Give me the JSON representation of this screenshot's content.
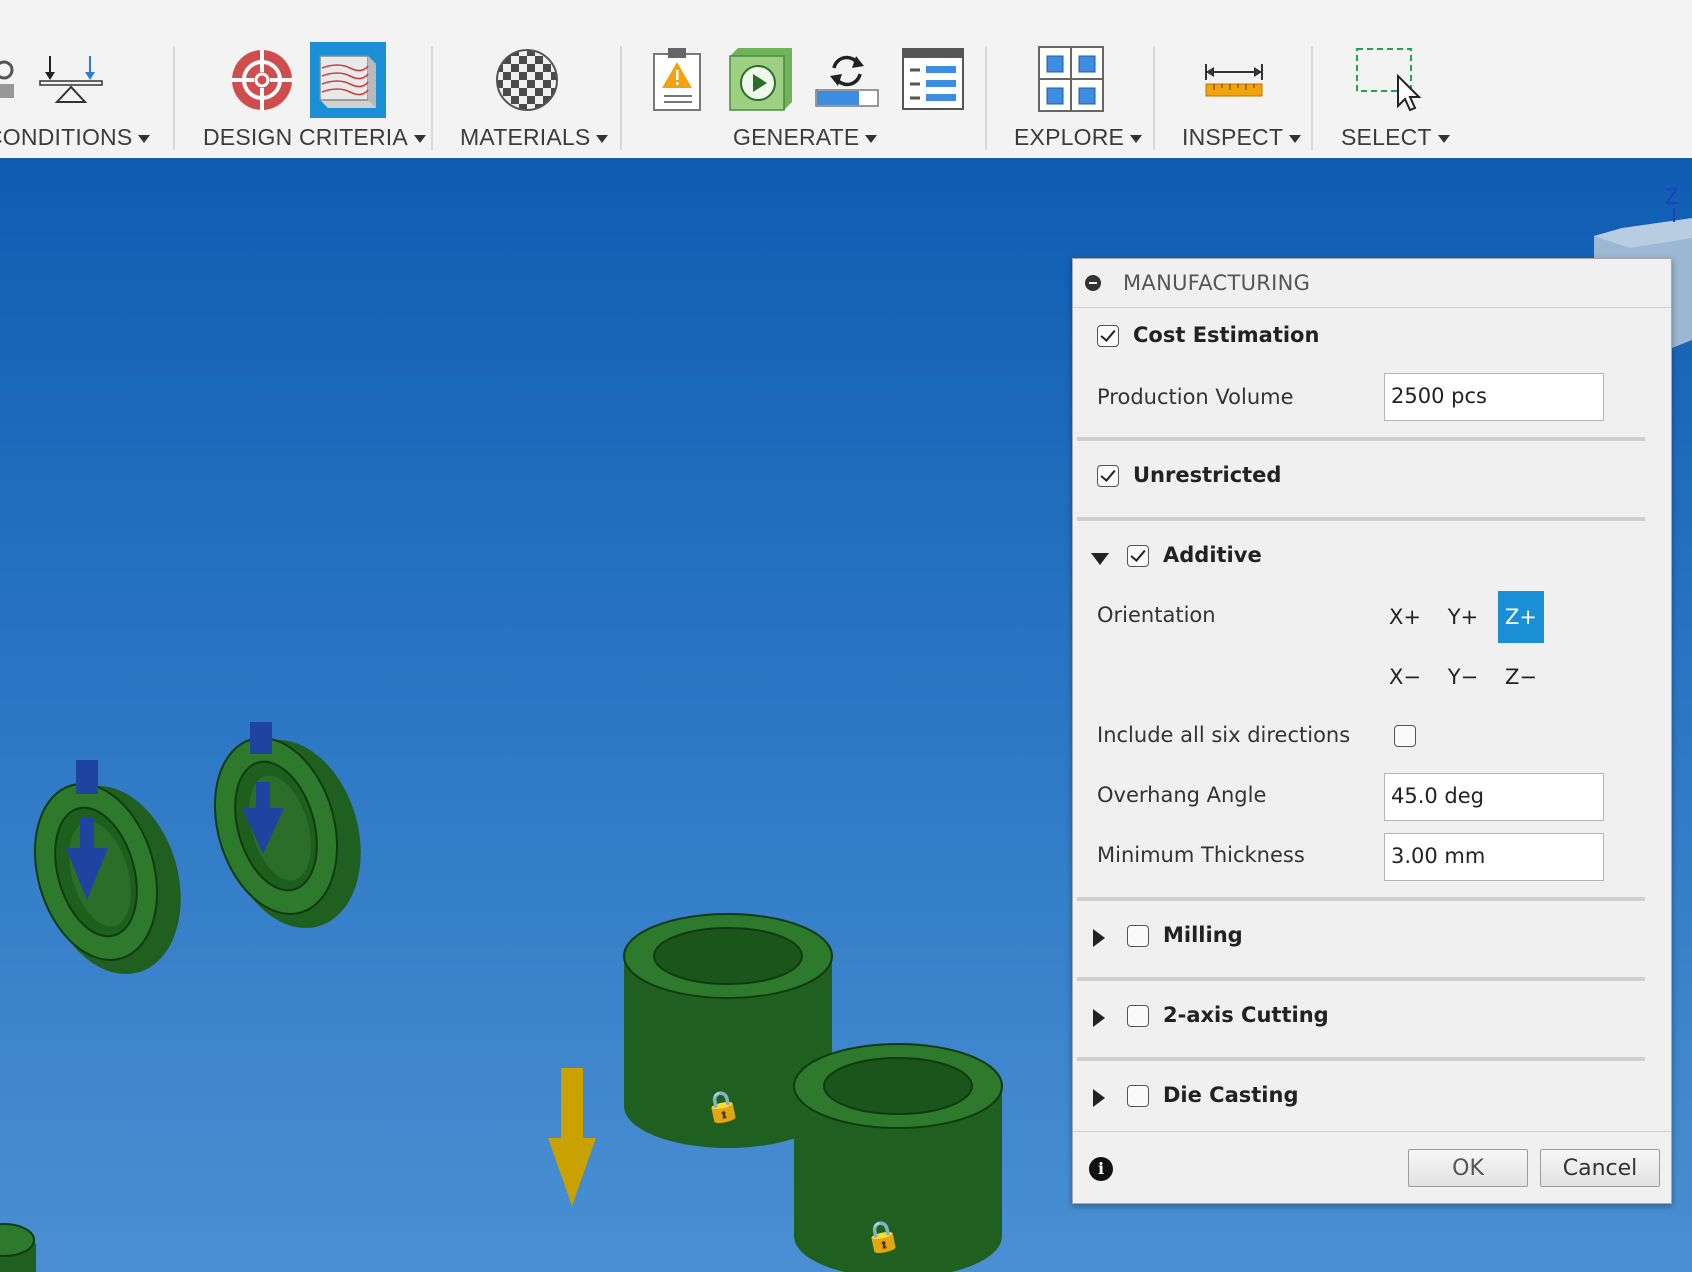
{
  "toolbar": {
    "groups": [
      {
        "name": "conditions",
        "label": "CONDITIONS"
      },
      {
        "name": "design-criteria",
        "label": "DESIGN CRITERIA"
      },
      {
        "name": "materials",
        "label": "MATERIALS"
      },
      {
        "name": "generate",
        "label": "GENERATE"
      },
      {
        "name": "explore",
        "label": "EXPLORE"
      },
      {
        "name": "inspect",
        "label": "INSPECT"
      },
      {
        "name": "select",
        "label": "SELECT"
      }
    ]
  },
  "viewcube": {
    "axis_label": "Z"
  },
  "dialog": {
    "title": "MANUFACTURING",
    "cost_estimation": {
      "label": "Cost Estimation",
      "checked": true
    },
    "production_volume": {
      "label": "Production Volume",
      "value": "2500 pcs"
    },
    "unrestricted": {
      "label": "Unrestricted",
      "checked": true
    },
    "additive": {
      "label": "Additive",
      "checked": true,
      "expanded": true,
      "orientation_label": "Orientation",
      "orientations": [
        "X+",
        "Y+",
        "Z+",
        "X−",
        "Y−",
        "Z−"
      ],
      "selected_orientation": "Z+",
      "six_directions_label": "Include all six directions",
      "six_directions_checked": false,
      "overhang_label": "Overhang Angle",
      "overhang_value": "45.0 deg",
      "min_thickness_label": "Minimum Thickness",
      "min_thickness_value": "3.00 mm"
    },
    "milling": {
      "label": "Milling",
      "checked": false
    },
    "two_axis": {
      "label": "2-axis Cutting",
      "checked": false
    },
    "die_casting": {
      "label": "Die Casting",
      "checked": false
    },
    "ok_label": "OK",
    "cancel_label": "Cancel"
  },
  "colors": {
    "accent": "#1a8fd6",
    "part_green": "#2d7a2c",
    "load_arrow": "#1e44a0",
    "gravity_arrow": "#c9a200",
    "viewport_top": "#0e5db3"
  }
}
